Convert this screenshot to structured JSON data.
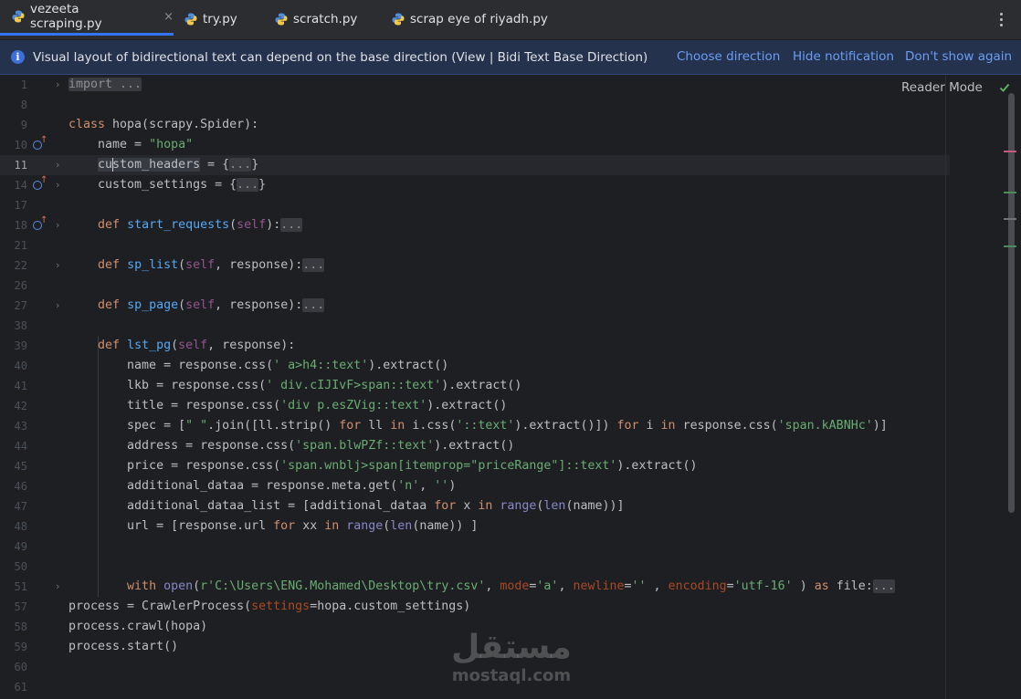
{
  "tabs": [
    {
      "label": "vezeeta scraping.py",
      "active": true,
      "closable": true
    },
    {
      "label": "try.py"
    },
    {
      "label": "scratch.py"
    },
    {
      "label": "scrap eye of riyadh.py"
    }
  ],
  "tab_close_glyph": "×",
  "notification": {
    "icon": "info-icon",
    "message": "Visual layout of bidirectional text can depend on the base direction (View | Bidi Text Base Direction)",
    "actions": [
      "Choose direction",
      "Hide notification",
      "Don't show again"
    ]
  },
  "editor": {
    "reader_mode_label": "Reader Mode",
    "current_line": "11",
    "line_numbers": [
      "1",
      "8",
      "9",
      "10",
      "11",
      "14",
      "17",
      "18",
      "21",
      "22",
      "26",
      "27",
      "38",
      "39",
      "40",
      "41",
      "42",
      "43",
      "44",
      "45",
      "46",
      "47",
      "48",
      "49",
      "50",
      "51",
      "57",
      "58",
      "59",
      "60",
      "61"
    ],
    "code": {
      "l1": "import ...",
      "l9_kw": "class",
      "l9_rest": " hopa(scrapy.Spider):",
      "l10_a": "    name = ",
      "l10_s": "\"hopa\"",
      "l11_a": "custom_headers",
      "l11_b": " = {",
      "l11_f": "...",
      "l11_c": "}",
      "l14_a": "    custom_settings = {",
      "l14_f": "...",
      "l14_c": "}",
      "def": "def",
      "self": "self",
      "ellipsis": "...",
      "l18_fn": "start_requests",
      "l22_fn": "sp_list",
      "l27_fn": "sp_page",
      "l39_fn": "lst_pg",
      "response_param": ", response):",
      "l40_a": "        name = response.css(",
      "l40_s": "' a>h4::text'",
      "l40_b": ").extract()",
      "l41_a": "        lkb = response.css(",
      "l41_s": "' div.cIJIvF>span::text'",
      "l41_b": ").extract()",
      "l42_a": "        title = response.css(",
      "l42_s": "'div p.esZVig::text'",
      "l42_b": ").extract()",
      "l43_a": "        spec = [",
      "l43_s1": "\" \"",
      "l43_b": ".join([ll.strip() ",
      "l43_for": "for",
      "l43_c": " ll ",
      "l43_in": "in",
      "l43_d": " i.css(",
      "l43_s2": "'::text'",
      "l43_e": ").extract()]) ",
      "l43_f": " i ",
      "l43_g": " response.css(",
      "l43_s3": "'span.kABNHc'",
      "l43_h": ")]",
      "l44_a": "        address = response.css(",
      "l44_s": "'span.blwPZf::text'",
      "l44_b": ").extract()",
      "l45_a": "        price = response.css(",
      "l45_s": "'span.wnblj>span[itemprop=\"priceRange\"]::text'",
      "l45_b": ").extract()",
      "l46_a": "        additional_dataa = response.meta.get(",
      "l46_s1": "'n'",
      "l46_b": ", ",
      "l46_s2": "''",
      "l46_c": ")",
      "l47_a": "        additional_dataa_list = [additional_dataa ",
      "l47_for": "for",
      "l47_b": " x ",
      "l47_in": "in",
      "l47_range": "range",
      "l47_len": "len",
      "l47_c": "(name))]",
      "l48_a": "        url = [response.url ",
      "l48_b": " xx ",
      "l48_c": "(name)) ]",
      "l51_with": "with",
      "l51_open": "open",
      "l51_s1": "r'C:\\Users\\ENG.Mohamed\\Desktop\\try.csv'",
      "l51_mode": "mode",
      "l51_s2": "'a'",
      "l51_newline": "newline",
      "l51_s3": "''",
      "l51_encoding": "encoding",
      "l51_s4": "'utf-16'",
      "l51_as": "as",
      "l51_file": " file:",
      "l57_a": "process = CrawlerProcess(",
      "l57_p": "settings",
      "l57_b": "=hopa.custom_settings)",
      "l58": "process.crawl(hopa)",
      "l59": "process.start()"
    }
  },
  "watermark": {
    "logo": "مستقل",
    "url": "mostaql.com"
  },
  "colors": {
    "accent": "#3574f0",
    "keyword": "#cf8e6d",
    "function": "#56a8f5",
    "string": "#6aab73",
    "self": "#94558d",
    "builtin": "#8888c6",
    "param": "#aa4926"
  }
}
